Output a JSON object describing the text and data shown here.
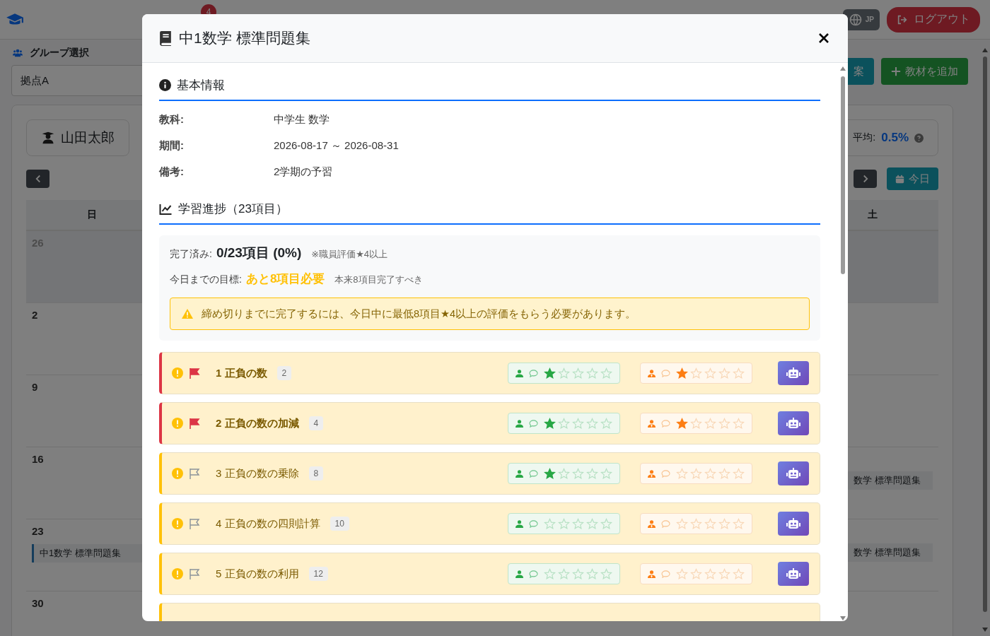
{
  "navbar": {
    "notification_count": "4",
    "language": "JP",
    "logout": "ログアウト"
  },
  "group": {
    "label": "グループ選択",
    "value": "拠点A"
  },
  "actions": [
    {
      "label": "案",
      "kind": "info"
    },
    {
      "label": "教材を追加",
      "kind": "add"
    }
  ],
  "student": {
    "name": "山田太郎",
    "average_label": "平均:",
    "average_value": "0.5%"
  },
  "calendar": {
    "today": "今日",
    "weekdays": [
      "日",
      "土"
    ],
    "weeks": [
      {
        "date": "26",
        "muted": true
      },
      {
        "date": "2",
        "muted": false
      },
      {
        "date": "9",
        "muted": false
      },
      {
        "date": "16",
        "muted": false,
        "sat_events": [
          "数学 標準問題集"
        ]
      },
      {
        "date": "23",
        "muted": false,
        "sun_events": [
          "中1数学 標準問題集"
        ],
        "sat_events": [
          "数学 標準問題集"
        ]
      },
      {
        "date": "30",
        "muted": false
      }
    ]
  },
  "modal": {
    "title": "中1数学 標準問題集",
    "basic_heading": "基本情報",
    "info": [
      {
        "label": "教科:",
        "value": "中学生 数学"
      },
      {
        "label": "期間:",
        "value": "2026-08-17 ～ 2026-08-31"
      },
      {
        "label": "備考:",
        "value": "2学期の予習"
      }
    ],
    "progress_heading": "学習進捗（23項目）",
    "completed_label": "完了済み:",
    "completed_value": "0/23項目 (0%)",
    "completed_note": "※職員評価★4以上",
    "target_label": "今日までの目標:",
    "target_value": "あと8項目必要",
    "target_note": "本来8項目完了すべき",
    "warning": "締め切りまでに完了するには、今日中に最低8項目★4以上の評価をもらう必要があります。",
    "items": [
      {
        "title": "1 正負の数",
        "count": "2",
        "flagged": true,
        "student": {
          "stars": 1
        },
        "staff": {
          "stars": 1
        }
      },
      {
        "title": "2 正負の数の加減",
        "count": "4",
        "flagged": true,
        "student": {
          "stars": 1
        },
        "staff": {
          "stars": 1
        }
      },
      {
        "title": "3 正負の数の乗除",
        "count": "8",
        "flagged": false,
        "student": {
          "stars": 1
        },
        "staff": {
          "stars": 0
        }
      },
      {
        "title": "4 正負の数の四則計算",
        "count": "10",
        "flagged": false,
        "student": {
          "stars": 0
        },
        "staff": {
          "stars": 0
        }
      },
      {
        "title": "5 正負の数の利用",
        "count": "12",
        "flagged": false,
        "student": {
          "stars": 0
        },
        "staff": {
          "stars": 0
        }
      }
    ]
  }
}
